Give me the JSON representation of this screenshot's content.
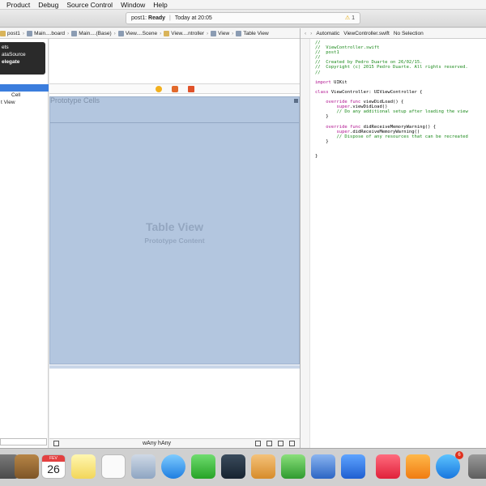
{
  "menubar": {
    "items": [
      "Product",
      "Debug",
      "Source Control",
      "Window",
      "Help"
    ]
  },
  "toolbar": {
    "status_project": "post1:",
    "status_state": "Ready",
    "status_time": "Today at 20:05",
    "warning_count": "1"
  },
  "jumpbar": {
    "crumbs": [
      "post1",
      "Main....board",
      "Main....(Base)",
      "View....Scene",
      "View....ntroller",
      "View",
      "Table View"
    ]
  },
  "jumpbar2": {
    "mode": "Automatic",
    "file": "ViewController.swift",
    "selection": "No Selection"
  },
  "outline": {
    "popup_items": [
      "ets",
      "ataSource",
      "elegate"
    ],
    "rows": [
      "Cell",
      "t View"
    ]
  },
  "canvas": {
    "prototype_cells": "Prototype Cells",
    "table_view_title": "Table View",
    "table_view_subtitle": "Prototype Content",
    "size_class": "wAny hAny"
  },
  "code": {
    "lines": [
      "//",
      "//  ViewController.swift",
      "//  post1",
      "//",
      "//  Created by Pedro Duarte on 26/02/15.",
      "//  Copyright (c) 2015 Pedro Duarte. All rights reserved.",
      "//",
      "",
      "import UIKit",
      "",
      "class ViewController: UIViewController {",
      "",
      "    override func viewDidLoad() {",
      "        super.viewDidLoad()",
      "        // Do any additional setup after loading the view",
      "    }",
      "",
      "    override func didReceiveMemoryWarning() {",
      "        super.didReceiveMemoryWarning()",
      "        // Dispose of any resources that can be recreated",
      "    }",
      "",
      "",
      "}"
    ]
  },
  "dock": {
    "calendar_month": "FEV",
    "calendar_day": "26",
    "appstore_badge": "6"
  },
  "colors": {
    "selection_blue": "#3b7ddd",
    "tableview_blue": "#b3c6df",
    "comment_green": "#1c8a1c",
    "keyword_purple": "#b0128f"
  }
}
